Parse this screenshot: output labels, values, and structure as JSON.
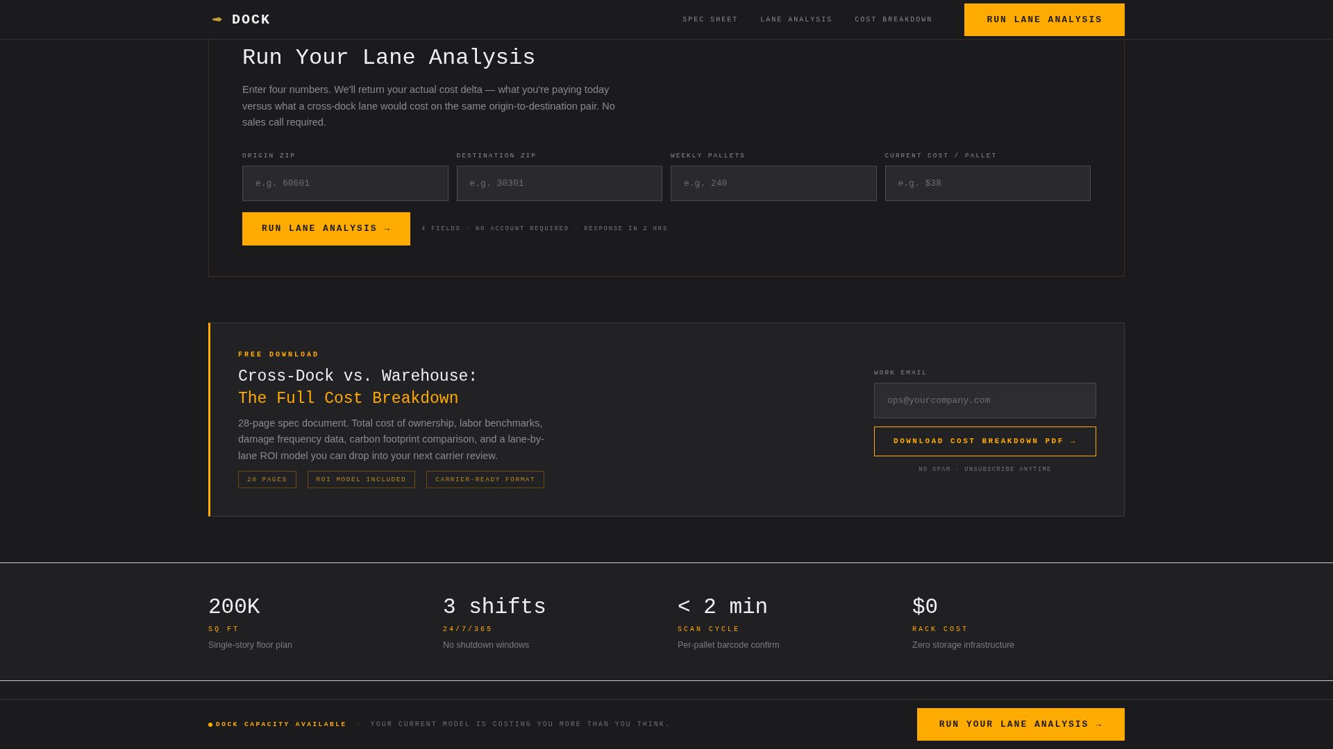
{
  "header": {
    "brand": "DOCK",
    "nav": [
      {
        "label": "SPEC SHEET"
      },
      {
        "label": "LANE ANALYSIS"
      },
      {
        "label": "COST BREAKDOWN"
      }
    ],
    "cta": "RUN LANE ANALYSIS"
  },
  "analysis": {
    "title": "Run Your Lane Analysis",
    "description": "Enter four numbers. We'll return your actual cost delta — what you're paying today versus what a cross-dock lane would cost on the same origin-to-destination pair. No sales call required.",
    "fields": [
      {
        "label": "ORIGIN ZIP",
        "placeholder": "e.g. 60601"
      },
      {
        "label": "DESTINATION ZIP",
        "placeholder": "e.g. 30301"
      },
      {
        "label": "WEEKLY PALLETS",
        "placeholder": "e.g. 240"
      },
      {
        "label": "CURRENT COST / PALLET",
        "placeholder": "e.g. $38"
      }
    ],
    "submit": "RUN LANE ANALYSIS →",
    "note": "4 FIELDS · NO ACCOUNT REQUIRED · RESPONSE IN 2 HRS"
  },
  "download": {
    "eyebrow": "FREE DOWNLOAD",
    "title_line1": "Cross-Dock vs. Warehouse:",
    "title_line2": "The Full Cost Breakdown",
    "description": "28-page spec document. Total cost of ownership, labor benchmarks, damage frequency data, carbon footprint comparison, and a lane-by-lane ROI model you can drop into your next carrier review.",
    "tags": [
      "28 PAGES",
      "ROI MODEL INCLUDED",
      "CARRIER-READY FORMAT"
    ],
    "email_label": "WORK EMAIL",
    "email_placeholder": "ops@yourcompany.com",
    "button": "DOWNLOAD COST BREAKDOWN PDF →",
    "note": "NO SPAM · UNSUBSCRIBE ANYTIME"
  },
  "stats": [
    {
      "value": "200K",
      "label": "SQ FT",
      "detail": "Single-story floor plan"
    },
    {
      "value": "3 shifts",
      "label": "24/7/365",
      "detail": "No shutdown windows"
    },
    {
      "value": "< 2 min",
      "label": "SCAN CYCLE",
      "detail": "Per-pallet barcode confirm"
    },
    {
      "value": "$0",
      "label": "RACK COST",
      "detail": "Zero storage infrastructure"
    }
  ],
  "footer_bar": {
    "status": "DOCK CAPACITY AVAILABLE",
    "separator": "·",
    "message": "YOUR CURRENT MODEL IS COSTING YOU MORE THAN YOU THINK.",
    "cta": "RUN YOUR LANE ANALYSIS →"
  }
}
